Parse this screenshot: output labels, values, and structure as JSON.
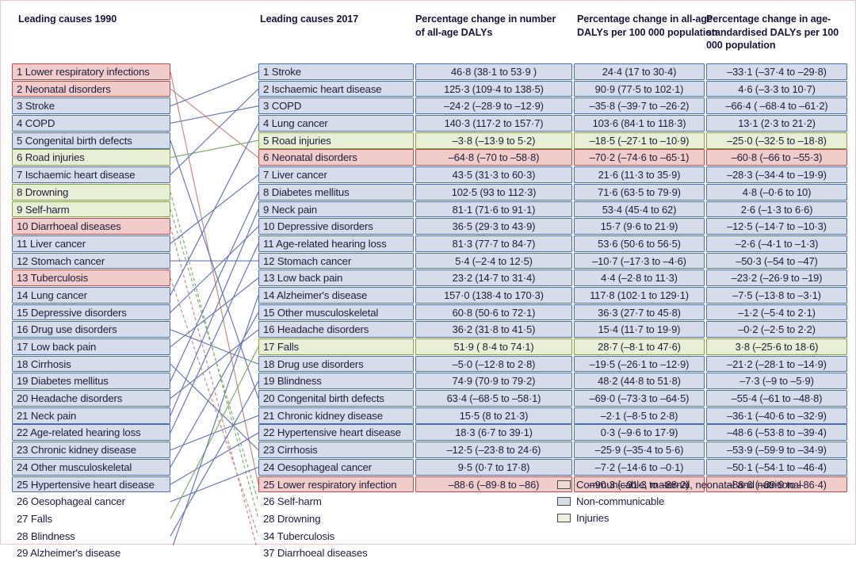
{
  "headers": {
    "left": "Leading causes 1990",
    "right": "Leading causes 2017",
    "pc1": "Percentage change in number of all-age DALYs",
    "pc2": "Percentage change in all-age DALYs per 100 000 population",
    "pc3": "Percentage change in age-standardised DALYs per 100 000 population"
  },
  "colors": {
    "communicable": "#f0cdcb",
    "communicable_border": "#c0484c",
    "noncommunicable": "#d7dcea",
    "noncommunicable_border": "#4a6fa8",
    "injuries": "#e9efd6",
    "injuries_border": "#84a23c",
    "frame": "#e9c9cd"
  },
  "legend": [
    {
      "key": "communicable",
      "label": "Communicable, maternal, neonatal and nutritional"
    },
    {
      "key": "noncommunicable",
      "label": "Non-communicable"
    },
    {
      "key": "injuries",
      "label": "Injuries"
    }
  ],
  "causes_1990": [
    {
      "rank": 1,
      "label": "1 Lower respiratory infections",
      "cat": "cmnn",
      "boxed": true
    },
    {
      "rank": 2,
      "label": "2 Neonatal disorders",
      "cat": "cmnn",
      "boxed": true
    },
    {
      "rank": 3,
      "label": "3 Stroke",
      "cat": "nc",
      "boxed": true
    },
    {
      "rank": 4,
      "label": "4 COPD",
      "cat": "nc",
      "boxed": true
    },
    {
      "rank": 5,
      "label": "5 Congenital birth defects",
      "cat": "nc",
      "boxed": true
    },
    {
      "rank": 6,
      "label": "6 Road injuries",
      "cat": "inj",
      "boxed": true
    },
    {
      "rank": 7,
      "label": "7 Ischaemic heart disease",
      "cat": "nc",
      "boxed": true
    },
    {
      "rank": 8,
      "label": "8 Drowning",
      "cat": "inj",
      "boxed": true
    },
    {
      "rank": 9,
      "label": "9 Self-harm",
      "cat": "inj",
      "boxed": true
    },
    {
      "rank": 10,
      "label": "10 Diarrhoeal diseases",
      "cat": "cmnn",
      "boxed": true
    },
    {
      "rank": 11,
      "label": "11 Liver cancer",
      "cat": "nc",
      "boxed": true
    },
    {
      "rank": 12,
      "label": "12 Stomach cancer",
      "cat": "nc",
      "boxed": true
    },
    {
      "rank": 13,
      "label": "13 Tuberculosis",
      "cat": "cmnn",
      "boxed": true
    },
    {
      "rank": 14,
      "label": "14 Lung cancer",
      "cat": "nc",
      "boxed": true
    },
    {
      "rank": 15,
      "label": "15 Depressive disorders",
      "cat": "nc",
      "boxed": true
    },
    {
      "rank": 16,
      "label": "16 Drug use disorders",
      "cat": "nc",
      "boxed": true
    },
    {
      "rank": 17,
      "label": "17 Low back pain",
      "cat": "nc",
      "boxed": true
    },
    {
      "rank": 18,
      "label": "18 Cirrhosis",
      "cat": "nc",
      "boxed": true
    },
    {
      "rank": 19,
      "label": "19 Diabetes mellitus",
      "cat": "nc",
      "boxed": true
    },
    {
      "rank": 20,
      "label": "20 Headache disorders",
      "cat": "nc",
      "boxed": true
    },
    {
      "rank": 21,
      "label": "21 Neck pain",
      "cat": "nc",
      "boxed": true
    },
    {
      "rank": 22,
      "label": "22 Age-related hearing loss",
      "cat": "nc",
      "boxed": true
    },
    {
      "rank": 23,
      "label": "23 Chronic kidney disease",
      "cat": "nc",
      "boxed": true
    },
    {
      "rank": 24,
      "label": "24 Other musculoskeletal",
      "cat": "nc",
      "boxed": true
    },
    {
      "rank": 25,
      "label": "25 Hypertensive heart disease",
      "cat": "nc",
      "boxed": true
    },
    {
      "rank": 26,
      "label": "26 Oesophageal cancer",
      "cat": "none",
      "boxed": false
    },
    {
      "rank": 27,
      "label": "27 Falls",
      "cat": "none",
      "boxed": false
    },
    {
      "rank": 28,
      "label": "28 Blindness",
      "cat": "none",
      "boxed": false
    },
    {
      "rank": 29,
      "label": "29 Alzheimer's disease",
      "cat": "none",
      "boxed": false
    }
  ],
  "causes_2017": [
    {
      "rank": 1,
      "label": "1 Stroke",
      "cat": "nc",
      "boxed": true
    },
    {
      "rank": 2,
      "label": "2 Ischaemic heart disease",
      "cat": "nc",
      "boxed": true
    },
    {
      "rank": 3,
      "label": "3 COPD",
      "cat": "nc",
      "boxed": true
    },
    {
      "rank": 4,
      "label": "4 Lung cancer",
      "cat": "nc",
      "boxed": true
    },
    {
      "rank": 5,
      "label": "5 Road injuries",
      "cat": "inj",
      "boxed": true
    },
    {
      "rank": 6,
      "label": "6 Neonatal disorders",
      "cat": "cmnn",
      "boxed": true
    },
    {
      "rank": 7,
      "label": "7 Liver cancer",
      "cat": "nc",
      "boxed": true
    },
    {
      "rank": 8,
      "label": "8 Diabetes mellitus",
      "cat": "nc",
      "boxed": true
    },
    {
      "rank": 9,
      "label": "9 Neck pain",
      "cat": "nc",
      "boxed": true
    },
    {
      "rank": 10,
      "label": "10 Depressive disorders",
      "cat": "nc",
      "boxed": true
    },
    {
      "rank": 11,
      "label": "11 Age-related hearing loss",
      "cat": "nc",
      "boxed": true
    },
    {
      "rank": 12,
      "label": "12 Stomach cancer",
      "cat": "nc",
      "boxed": true
    },
    {
      "rank": 13,
      "label": "13 Low back pain",
      "cat": "nc",
      "boxed": true
    },
    {
      "rank": 14,
      "label": "14 Alzheimer's disease",
      "cat": "nc",
      "boxed": true
    },
    {
      "rank": 15,
      "label": "15 Other musculoskeletal",
      "cat": "nc",
      "boxed": true
    },
    {
      "rank": 16,
      "label": "16 Headache disorders",
      "cat": "nc",
      "boxed": true
    },
    {
      "rank": 17,
      "label": "17 Falls",
      "cat": "inj",
      "boxed": true
    },
    {
      "rank": 18,
      "label": "18 Drug use disorders",
      "cat": "nc",
      "boxed": true
    },
    {
      "rank": 19,
      "label": "19 Blindness",
      "cat": "nc",
      "boxed": true
    },
    {
      "rank": 20,
      "label": "20 Congenital birth defects",
      "cat": "nc",
      "boxed": true
    },
    {
      "rank": 21,
      "label": "21 Chronic kidney disease",
      "cat": "nc",
      "boxed": true
    },
    {
      "rank": 22,
      "label": "22 Hypertensive heart disease",
      "cat": "nc",
      "boxed": true
    },
    {
      "rank": 23,
      "label": "23 Cirrhosis",
      "cat": "nc",
      "boxed": true
    },
    {
      "rank": 24,
      "label": "24 Oesophageal cancer",
      "cat": "nc",
      "boxed": true
    },
    {
      "rank": 25,
      "label": "25 Lower respiratory infection",
      "cat": "cmnn",
      "boxed": true
    },
    {
      "rank": 26,
      "label": "26 Self-harm",
      "cat": "none",
      "boxed": false
    },
    {
      "rank": 28,
      "label": "28 Drowning",
      "cat": "none",
      "boxed": false
    },
    {
      "rank": 34,
      "label": "34 Tuberculosis",
      "cat": "none",
      "boxed": false
    },
    {
      "rank": 37,
      "label": "37 Diarrhoeal diseases",
      "cat": "none",
      "boxed": false
    }
  ],
  "pct_change_number_all_age": [
    {
      "value": "46·8 (38·1 to 53·9 )",
      "cat": "nc"
    },
    {
      "value": "125·3 (109·4 to 138·5)",
      "cat": "nc"
    },
    {
      "value": "–24·2 (–28·9 to –12·9)",
      "cat": "nc"
    },
    {
      "value": "140·3 (117·2 to 157·7)",
      "cat": "nc"
    },
    {
      "value": "–3·8 (–13·9 to 5·2)",
      "cat": "inj"
    },
    {
      "value": "–64·8 (–70 to –58·8)",
      "cat": "cmnn"
    },
    {
      "value": "43·5 (31·3 to 60·3)",
      "cat": "nc"
    },
    {
      "value": "102·5 (93 to 112·3)",
      "cat": "nc"
    },
    {
      "value": "81·1 (71·6 to 91·1)",
      "cat": "nc"
    },
    {
      "value": "36·5 (29·3 to 43·9)",
      "cat": "nc"
    },
    {
      "value": "81·3 (77·7 to 84·7)",
      "cat": "nc"
    },
    {
      "value": "5·4 (–2·4 to 12·5)",
      "cat": "nc"
    },
    {
      "value": "23·2 (14·7 to 31·4)",
      "cat": "nc"
    },
    {
      "value": "157·0 (138·4 to 170·3)",
      "cat": "nc"
    },
    {
      "value": "60·8 (50·6 to 72·1)",
      "cat": "nc"
    },
    {
      "value": "36·2 (31·8 to 41·5)",
      "cat": "nc"
    },
    {
      "value": "51·9 ( 8·4 to 74·1)",
      "cat": "inj"
    },
    {
      "value": "–5·0 (–12·8 to 2·8)",
      "cat": "nc"
    },
    {
      "value": "74·9 (70·9 to 79·2)",
      "cat": "nc"
    },
    {
      "value": "63·4 (–68·5 to –58·1)",
      "cat": "nc"
    },
    {
      "value": "15·5 (8 to 21·3)",
      "cat": "nc"
    },
    {
      "value": "18·3 (6·7 to 39·1)",
      "cat": "nc"
    },
    {
      "value": "–12·5 (–23·8 to 24·6)",
      "cat": "nc"
    },
    {
      "value": "9·5 (0·7 to 17·8)",
      "cat": "nc"
    },
    {
      "value": "–88·6 (–89·8 to –86)",
      "cat": "cmnn"
    }
  ],
  "pct_change_all_age_per_100k": [
    {
      "value": "24·4 (17 to 30·4)",
      "cat": "nc"
    },
    {
      "value": "90·9 (77·5 to 102·1)",
      "cat": "nc"
    },
    {
      "value": "–35·8 (–39·7 to –26·2)",
      "cat": "nc"
    },
    {
      "value": "103·6 (84·1 to 118·3)",
      "cat": "nc"
    },
    {
      "value": "–18·5 (–27·1 to –10·9)",
      "cat": "inj"
    },
    {
      "value": "–70·2 (–74·6 to –65·1)",
      "cat": "cmnn"
    },
    {
      "value": "21·6 (11·3 to 35·9)",
      "cat": "nc"
    },
    {
      "value": "71·6 (63·5 to 79·9)",
      "cat": "nc"
    },
    {
      "value": "53·4 (45·4 to 62)",
      "cat": "nc"
    },
    {
      "value": "15·7 (9·6 to 21·9)",
      "cat": "nc"
    },
    {
      "value": "53·6 (50·6 to 56·5)",
      "cat": "nc"
    },
    {
      "value": "–10·7 (–17·3 to –4·6)",
      "cat": "nc"
    },
    {
      "value": "4·4 (–2·8 to 11·3)",
      "cat": "nc"
    },
    {
      "value": "117·8 (102·1 to 129·1)",
      "cat": "nc"
    },
    {
      "value": "36·3 (27·7 to 45·8)",
      "cat": "nc"
    },
    {
      "value": "15·4 (11·7 to 19·9)",
      "cat": "nc"
    },
    {
      "value": "28·7 (–8·1 to 47·6)",
      "cat": "inj"
    },
    {
      "value": "–19·5 (–26·1 to –12·9)",
      "cat": "nc"
    },
    {
      "value": "48·2 (44·8 to 51·8)",
      "cat": "nc"
    },
    {
      "value": "–69·0 (–73·3 to –64·5)",
      "cat": "nc"
    },
    {
      "value": "–2·1 (–8·5 to 2·8)",
      "cat": "nc"
    },
    {
      "value": "0·3 (–9·6 to 17·9)",
      "cat": "nc"
    },
    {
      "value": "–25·9 (–35·4 to 5·6)",
      "cat": "nc"
    },
    {
      "value": "–7·2 (–14·6 to –0·1)",
      "cat": "nc"
    },
    {
      "value": "–90·3 (–91·3 to –88·2)",
      "cat": "cmnn"
    }
  ],
  "pct_change_age_standardised": [
    {
      "value": "–33·1 (–37·4 to –29·8)",
      "cat": "nc"
    },
    {
      "value": "4·6 (–3·3 to 10·7)",
      "cat": "nc"
    },
    {
      "value": "–66·4 ( –68·4 to –61·2)",
      "cat": "nc"
    },
    {
      "value": "13·1 (2·3 to 21·2)",
      "cat": "nc"
    },
    {
      "value": "–25·0 (–32·5 to –18·8)",
      "cat": "inj"
    },
    {
      "value": "–60·8 (–66 to –55·3)",
      "cat": "cmnn"
    },
    {
      "value": "–28·3 (–34·4 to –19·9)",
      "cat": "nc"
    },
    {
      "value": "4·8 (–0·6 to 10)",
      "cat": "nc"
    },
    {
      "value": "2·6 (–1·3 to 6·6)",
      "cat": "nc"
    },
    {
      "value": "–12·5 (–14·7 to –10·3)",
      "cat": "nc"
    },
    {
      "value": "–2·6 (–4·1 to –1·3)",
      "cat": "nc"
    },
    {
      "value": "–50·3 (–54 to –47)",
      "cat": "nc"
    },
    {
      "value": "–23·2 (–26·9 to –19)",
      "cat": "nc"
    },
    {
      "value": "–7·5 (–13·8 to –3·1)",
      "cat": "nc"
    },
    {
      "value": "–1·2 (–5·4 to 2·1)",
      "cat": "nc"
    },
    {
      "value": "–0·2 (–2·5 to 2·2)",
      "cat": "nc"
    },
    {
      "value": "3·8 (–25·6 to 18·6)",
      "cat": "inj"
    },
    {
      "value": "–21·2 (–28·1 to –14·9)",
      "cat": "nc"
    },
    {
      "value": "–7·3 (–9 to –5·9)",
      "cat": "nc"
    },
    {
      "value": "–55·4 (–61 to –48·8)",
      "cat": "nc"
    },
    {
      "value": "–36·1 (–40·6 to –32·9)",
      "cat": "nc"
    },
    {
      "value": "–48·6 (–53·8 to –39·4)",
      "cat": "nc"
    },
    {
      "value": "–53·9 (–59·9 to –34·9)",
      "cat": "nc"
    },
    {
      "value": "–50·1 (–54·1 to –46·4)",
      "cat": "nc"
    },
    {
      "value": "–88·6 (–89·9 to –86·4)",
      "cat": "cmnn"
    }
  ],
  "links": [
    {
      "from": 1,
      "to": 25,
      "cat": "cmnn",
      "style": "solid"
    },
    {
      "from": 2,
      "to": 6,
      "cat": "cmnn",
      "style": "solid"
    },
    {
      "from": 3,
      "to": 1,
      "cat": "nc",
      "style": "solid"
    },
    {
      "from": 4,
      "to": 3,
      "cat": "nc",
      "style": "solid"
    },
    {
      "from": 5,
      "to": 20,
      "cat": "nc",
      "style": "solid"
    },
    {
      "from": 6,
      "to": 5,
      "cat": "inj",
      "style": "solid"
    },
    {
      "from": 7,
      "to": 2,
      "cat": "nc",
      "style": "solid"
    },
    {
      "from": 8,
      "to": 28,
      "cat": "inj",
      "style": "dashed"
    },
    {
      "from": 9,
      "to": 26,
      "cat": "inj",
      "style": "dashed"
    },
    {
      "from": 10,
      "to": 37,
      "cat": "cmnn",
      "style": "dashed"
    },
    {
      "from": 11,
      "to": 7,
      "cat": "nc",
      "style": "solid"
    },
    {
      "from": 12,
      "to": 12,
      "cat": "nc",
      "style": "solid"
    },
    {
      "from": 13,
      "to": 34,
      "cat": "cmnn",
      "style": "dashed"
    },
    {
      "from": 14,
      "to": 4,
      "cat": "nc",
      "style": "solid"
    },
    {
      "from": 15,
      "to": 10,
      "cat": "nc",
      "style": "solid"
    },
    {
      "from": 16,
      "to": 18,
      "cat": "nc",
      "style": "solid"
    },
    {
      "from": 17,
      "to": 13,
      "cat": "nc",
      "style": "solid"
    },
    {
      "from": 18,
      "to": 23,
      "cat": "nc",
      "style": "solid"
    },
    {
      "from": 19,
      "to": 8,
      "cat": "nc",
      "style": "solid"
    },
    {
      "from": 20,
      "to": 16,
      "cat": "nc",
      "style": "solid"
    },
    {
      "from": 21,
      "to": 9,
      "cat": "nc",
      "style": "solid"
    },
    {
      "from": 22,
      "to": 11,
      "cat": "nc",
      "style": "solid"
    },
    {
      "from": 23,
      "to": 21,
      "cat": "nc",
      "style": "solid"
    },
    {
      "from": 24,
      "to": 15,
      "cat": "nc",
      "style": "solid"
    },
    {
      "from": 25,
      "to": 22,
      "cat": "nc",
      "style": "solid"
    },
    {
      "from": 26,
      "to": 24,
      "cat": "nc",
      "style": "solid"
    },
    {
      "from": 27,
      "to": 17,
      "cat": "inj",
      "style": "solid"
    },
    {
      "from": 28,
      "to": 19,
      "cat": "nc",
      "style": "solid"
    },
    {
      "from": 29,
      "to": 14,
      "cat": "nc",
      "style": "solid"
    }
  ]
}
